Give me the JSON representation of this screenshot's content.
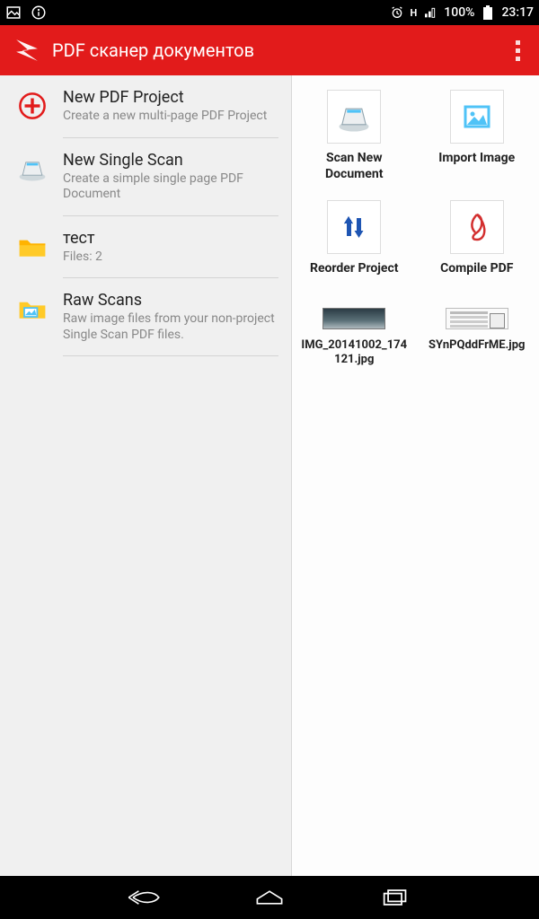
{
  "status": {
    "battery_pct": "100%",
    "time": "23:17",
    "network_indicator": "H"
  },
  "appbar": {
    "title": "PDF сканер документов"
  },
  "sidebar": {
    "items": [
      {
        "title": "New PDF Project",
        "sub": "Create a new multi-page PDF Project"
      },
      {
        "title": "New Single Scan",
        "sub": "Create a simple single page PDF Document"
      },
      {
        "title": "тест",
        "sub": "Files: 2"
      },
      {
        "title": "Raw Scans",
        "sub": "Raw image files from your non-project Single Scan PDF files."
      }
    ]
  },
  "actions": [
    {
      "label": "Scan New Document"
    },
    {
      "label": "Import Image"
    },
    {
      "label": "Reorder Project"
    },
    {
      "label": "Compile PDF"
    }
  ],
  "thumbnails": [
    {
      "label": "IMG_20141002_174121.jpg"
    },
    {
      "label": "SYnPQddFrME.jpg"
    }
  ]
}
